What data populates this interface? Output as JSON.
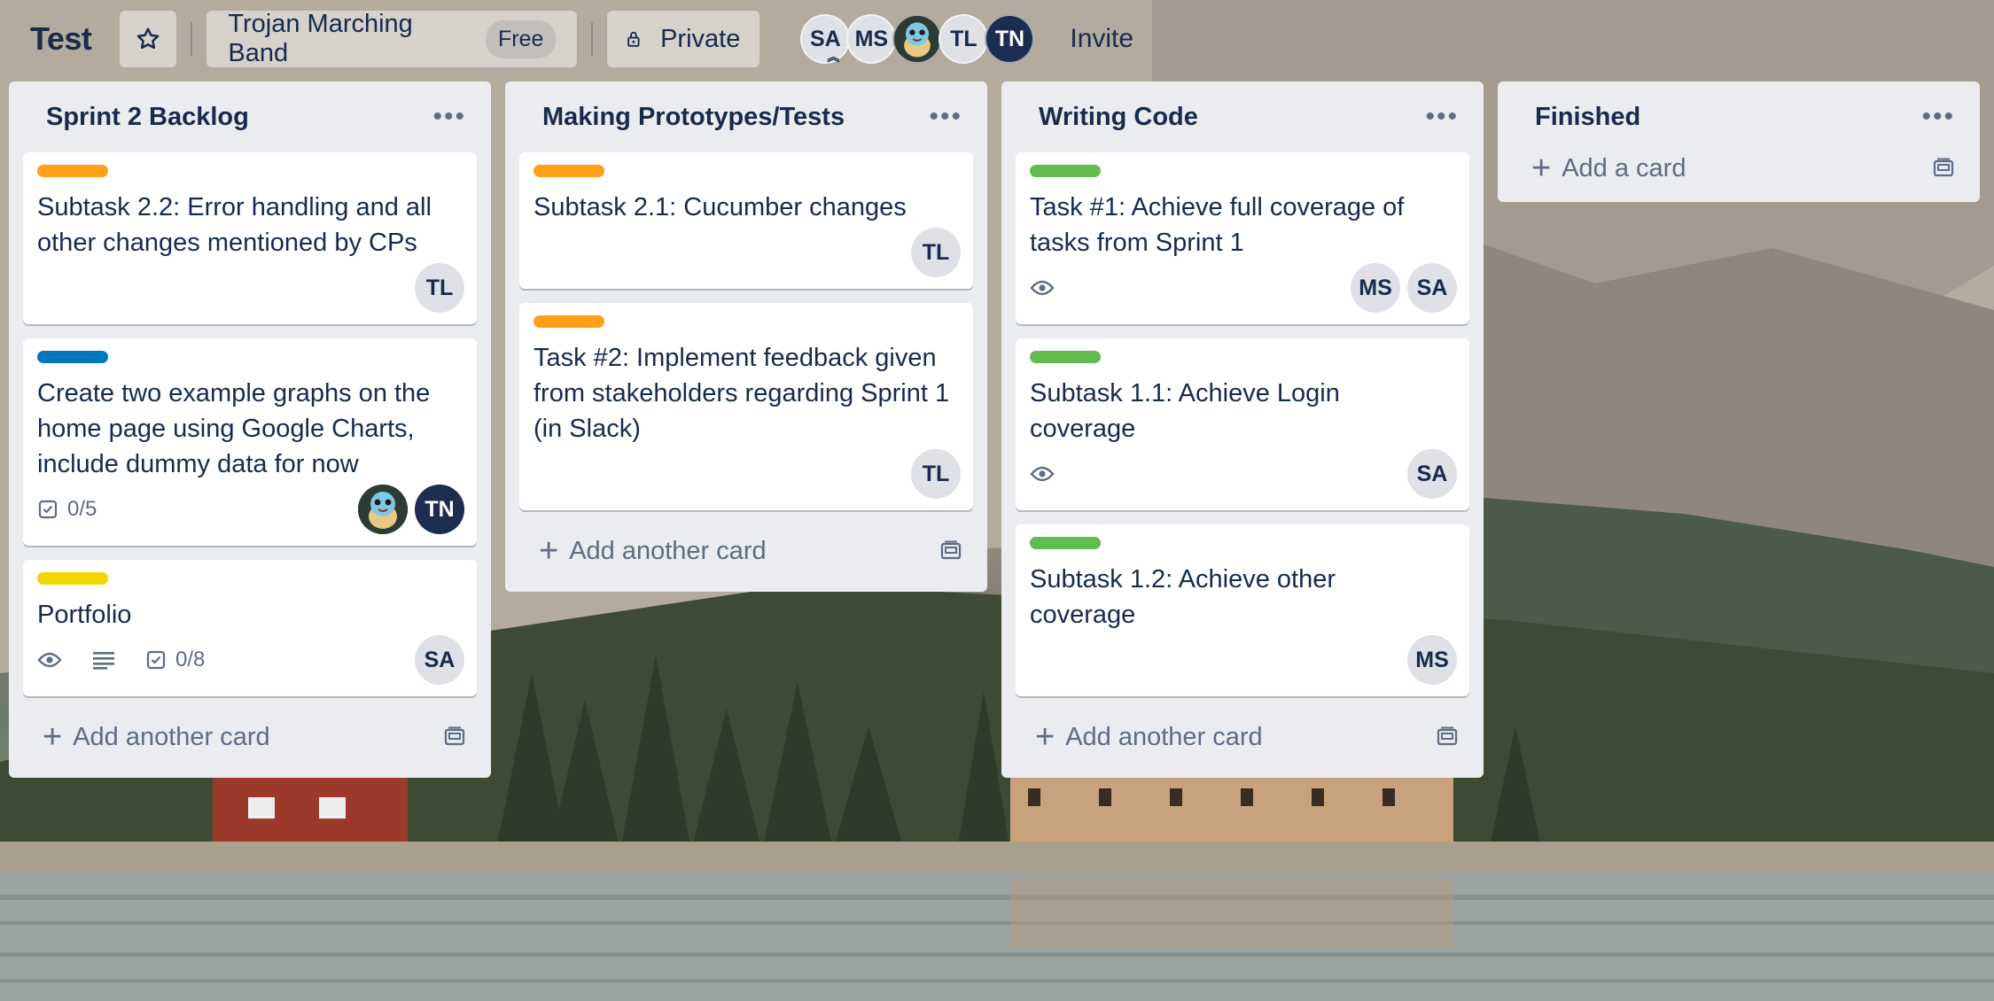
{
  "board": {
    "title": "Test",
    "team_name": "Trojan Marching Band",
    "team_badge": "Free",
    "visibility": "Private",
    "invite_label": "Invite",
    "members": [
      "SA",
      "MS",
      "TL",
      "TN"
    ]
  },
  "lists": [
    {
      "title": "Sprint 2 Backlog",
      "add_label": "Add another card",
      "cards": [
        {
          "label_color": "#ff9f1a",
          "text": "Subtask 2.2: Error handling and all other changes mentioned by CPs",
          "members": [
            "TL"
          ]
        },
        {
          "label_color": "#0079bf",
          "text": "Create two example graphs on the home page using Google Charts, include dummy data for now",
          "checklist": "0/5",
          "members": [
            "TN"
          ]
        },
        {
          "label_color": "#f2d600",
          "text": "Portfolio",
          "checklist": "0/8",
          "members": [
            "SA"
          ]
        }
      ]
    },
    {
      "title": "Making Prototypes/Tests",
      "add_label": "Add another card",
      "cards": [
        {
          "label_color": "#ff9f1a",
          "text": "Subtask 2.1: Cucumber changes",
          "members": [
            "TL"
          ]
        },
        {
          "label_color": "#ff9f1a",
          "text": "Task #2: Implement feedback given from stakeholders regarding Sprint 1 (in Slack)",
          "members": [
            "TL"
          ]
        }
      ]
    },
    {
      "title": "Writing Code",
      "add_label": "Add another card",
      "cards": [
        {
          "label_color": "#61bd4f",
          "text": "Task #1: Achieve full coverage of tasks from Sprint 1",
          "members": [
            "MS",
            "SA"
          ]
        },
        {
          "label_color": "#61bd4f",
          "text": "Subtask 1.1: Achieve Login coverage",
          "members": [
            "SA"
          ]
        },
        {
          "label_color": "#61bd4f",
          "text": "Subtask 1.2: Achieve other coverage",
          "members": [
            "MS"
          ]
        }
      ]
    },
    {
      "title": "Finished",
      "add_label": "Add a card",
      "cards": []
    }
  ],
  "colors": {
    "list_bg": "#ebecf0",
    "text": "#172b4d",
    "muted": "#5e6c84",
    "avatar_dark": "#1d2d4f"
  },
  "icons": [
    "star-icon",
    "lock-icon",
    "more-icon",
    "eye-icon",
    "description-icon",
    "checklist-icon",
    "plus-icon",
    "template-icon"
  ]
}
